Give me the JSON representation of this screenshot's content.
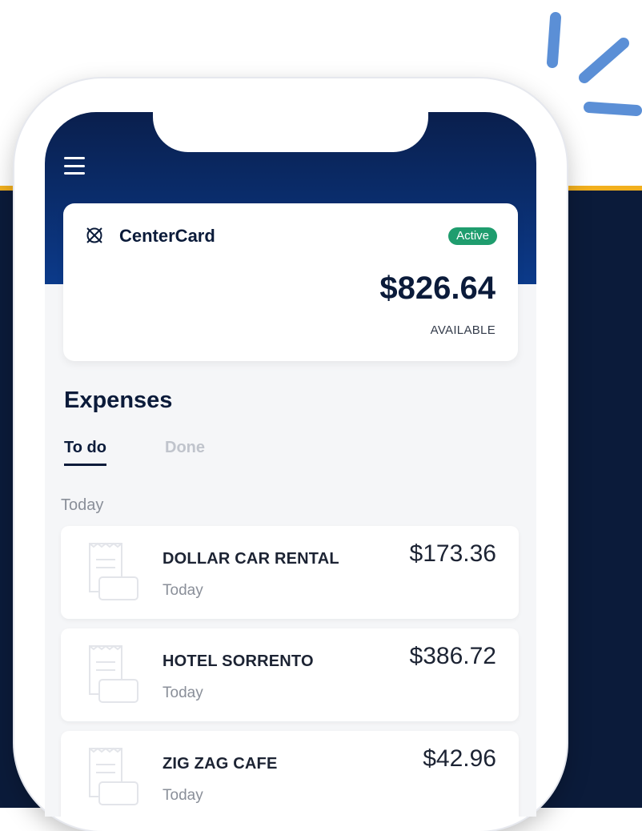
{
  "card": {
    "brand": "CenterCard",
    "status": "Active",
    "balance": "$826.64",
    "balance_label": "AVAILABLE"
  },
  "expenses": {
    "title": "Expenses",
    "tabs": [
      {
        "label": "To do",
        "active": true
      },
      {
        "label": "Done",
        "active": false
      }
    ],
    "group_label": "Today",
    "items": [
      {
        "name": "DOLLAR CAR RENTAL",
        "date": "Today",
        "amount": "$173.36"
      },
      {
        "name": "HOTEL SORRENTO",
        "date": "Today",
        "amount": "$386.72"
      },
      {
        "name": "ZIG ZAG CAFE",
        "date": "Today",
        "amount": "$42.96"
      }
    ]
  },
  "colors": {
    "navy": "#0b1b3a",
    "header_blue": "#0b3a8a",
    "gold": "#f2b01e",
    "active_green": "#1f9d6e",
    "sparkle_blue": "#5b8fd6"
  },
  "icons": [
    "menu-icon",
    "centercard-logo-icon",
    "receipt-icon",
    "sparkle-decoration"
  ]
}
